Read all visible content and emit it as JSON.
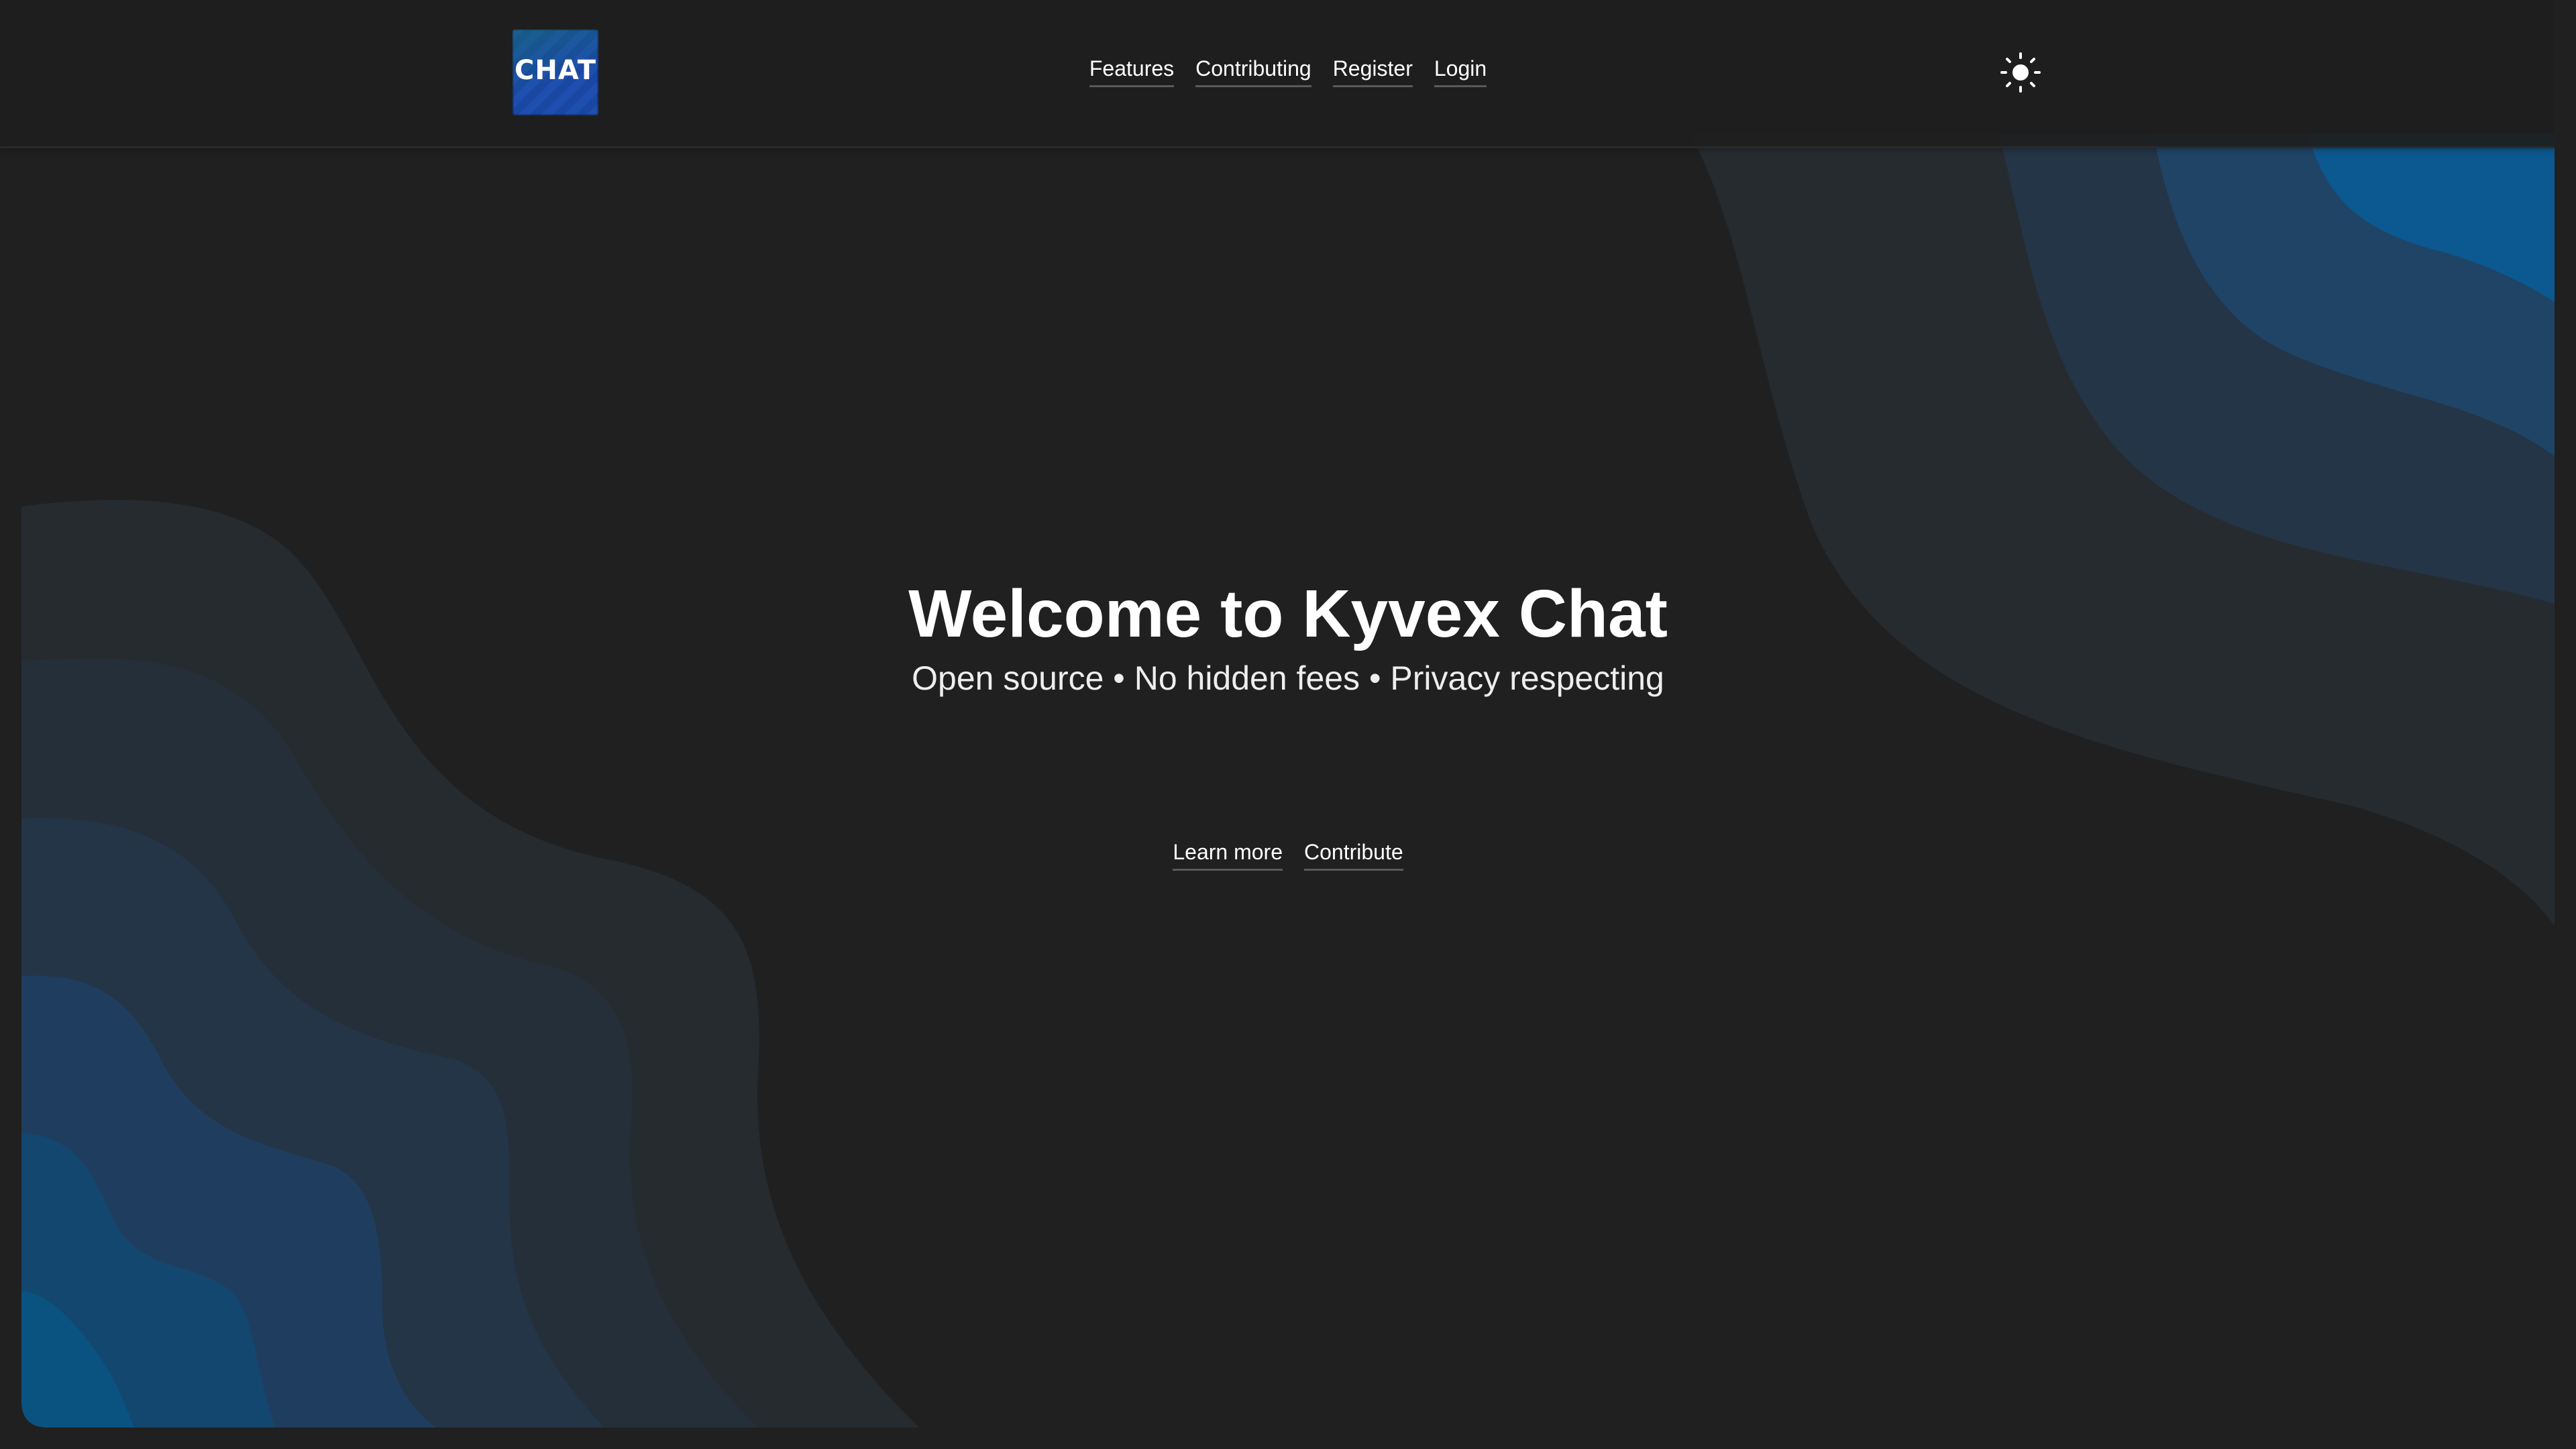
{
  "header": {
    "logo_text": "CHAT",
    "nav": [
      {
        "label": "Features"
      },
      {
        "label": "Contributing"
      },
      {
        "label": "Register"
      },
      {
        "label": "Login"
      }
    ],
    "theme_icon": "sun-icon"
  },
  "hero": {
    "title": "Welcome to Kyvex Chat",
    "subtitle": "Open source • No hidden fees • Privacy respecting"
  },
  "cta": {
    "learn_more": "Learn more",
    "contribute": "Contribute"
  },
  "colors": {
    "background": "#202020",
    "wave_dark": "#262b30",
    "wave_mid": "#243547",
    "wave_blue": "#1c4a74",
    "wave_bright": "#0a5b95"
  }
}
